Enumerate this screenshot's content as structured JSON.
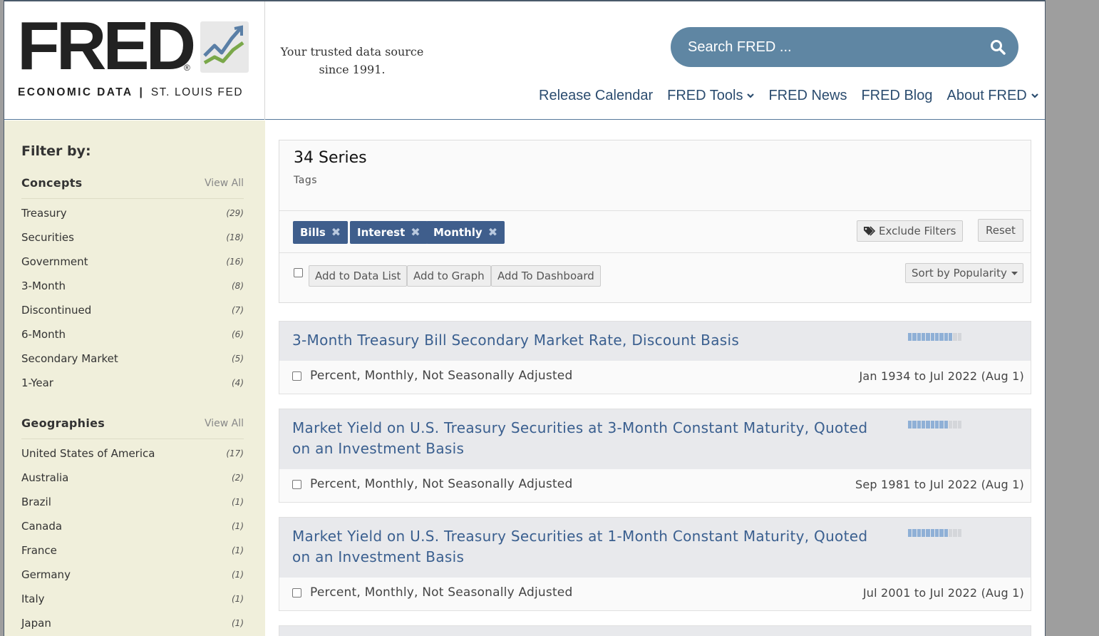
{
  "header": {
    "logo": {
      "wordmark": "FRED",
      "registered": "®",
      "sub_left": "ECONOMIC DATA",
      "sub_sep": "|",
      "sub_right": "ST. LOUIS FED"
    },
    "tagline_line1": "Your trusted data source",
    "tagline_line2": "since 1991.",
    "search": {
      "placeholder": "Search FRED ..."
    },
    "nav": [
      {
        "label": "Release Calendar",
        "has_caret": false
      },
      {
        "label": "FRED Tools",
        "has_caret": true
      },
      {
        "label": "FRED News",
        "has_caret": false
      },
      {
        "label": "FRED Blog",
        "has_caret": false
      },
      {
        "label": "About FRED",
        "has_caret": true
      }
    ]
  },
  "sidebar": {
    "title": "Filter by:",
    "concepts": {
      "title": "Concepts",
      "view_all": "View All",
      "items": [
        {
          "label": "Treasury",
          "count": "(29)"
        },
        {
          "label": "Securities",
          "count": "(18)"
        },
        {
          "label": "Government",
          "count": "(16)"
        },
        {
          "label": "3-Month",
          "count": "(8)"
        },
        {
          "label": "Discontinued",
          "count": "(7)"
        },
        {
          "label": "6-Month",
          "count": "(6)"
        },
        {
          "label": "Secondary Market",
          "count": "(5)"
        },
        {
          "label": "1-Year",
          "count": "(4)"
        }
      ]
    },
    "geographies": {
      "title": "Geographies",
      "view_all": "View All",
      "items": [
        {
          "label": "United States of America",
          "count": "(17)"
        },
        {
          "label": "Australia",
          "count": "(2)"
        },
        {
          "label": "Brazil",
          "count": "(1)"
        },
        {
          "label": "Canada",
          "count": "(1)"
        },
        {
          "label": "France",
          "count": "(1)"
        },
        {
          "label": "Germany",
          "count": "(1)"
        },
        {
          "label": "Italy",
          "count": "(1)"
        },
        {
          "label": "Japan",
          "count": "(1)"
        }
      ]
    }
  },
  "main": {
    "series_count": "34 Series",
    "tags_label": "Tags",
    "active_tags": [
      "Bills",
      "Interest",
      "Monthly"
    ],
    "tag_remove_glyph": "✖",
    "exclude_filters": "Exclude Filters",
    "reset": "Reset",
    "add_to_data_list": "Add to Data List",
    "add_to_graph": "Add to Graph",
    "add_to_dashboard": "Add To Dashboard",
    "sort_by": "Sort by Popularity",
    "results": [
      {
        "title": "3-Month Treasury Bill Secondary Market Rate, Discount Basis",
        "units": "Percent, Monthly, Not Seasonally Adjusted",
        "range": "Jan 1934 to Jul 2022 (Aug 1)",
        "popularity_of_12": 10
      },
      {
        "title": "Market Yield on U.S. Treasury Securities at 3-Month Constant Maturity, Quoted on an Investment Basis",
        "units": "Percent, Monthly, Not Seasonally Adjusted",
        "range": "Sep 1981 to Jul 2022 (Aug 1)",
        "popularity_of_12": 9
      },
      {
        "title": "Market Yield on U.S. Treasury Securities at 1-Month Constant Maturity, Quoted on an Investment Basis",
        "units": "Percent, Monthly, Not Seasonally Adjusted",
        "range": "Jul 2001 to Jul 2022 (Aug 1)",
        "popularity_of_12": 9
      }
    ]
  },
  "colors": {
    "brand_blue": "#3f5e8c",
    "search_bg": "#5f86a3",
    "nav_text": "#2b4c6f",
    "sidebar_bg": "#f0efdb",
    "link_blue": "#3a5f8f"
  }
}
